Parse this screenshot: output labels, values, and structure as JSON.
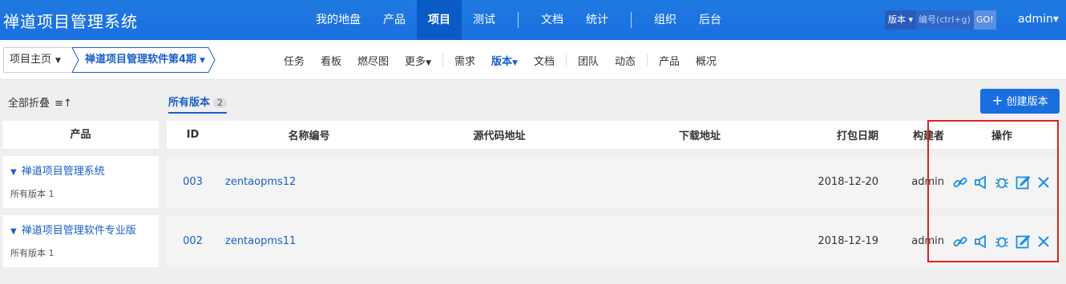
{
  "app": {
    "title": "禅道项目管理系统"
  },
  "main_nav": [
    {
      "label": "我的地盘",
      "active": false
    },
    {
      "label": "产品",
      "active": false
    },
    {
      "label": "项目",
      "active": true
    },
    {
      "label": "测试",
      "active": false
    },
    {
      "label": "文档",
      "active": false
    },
    {
      "label": "统计",
      "active": false
    },
    {
      "label": "组织",
      "active": false
    },
    {
      "label": "后台",
      "active": false
    }
  ],
  "search": {
    "type_label": "版本",
    "placeholder": "编号(ctrl+g)",
    "go_label": "GO!"
  },
  "user": {
    "name": "admin"
  },
  "breadcrumb": {
    "home": "项目主页",
    "project": "禅道项目管理软件第4期"
  },
  "sub_nav": [
    "任务",
    "看板",
    "燃尽图",
    "更多",
    "需求",
    "版本",
    "文档",
    "团队",
    "动态",
    "产品",
    "概况"
  ],
  "toolbar": {
    "fold_all": "全部折叠",
    "tab_label": "所有版本",
    "tab_count": "2",
    "create_label": "创建版本"
  },
  "left_panel": {
    "header": "产品",
    "products": [
      {
        "name": "禅道项目管理系统",
        "count_label": "所有版本 1"
      },
      {
        "name": "禅道项目管理软件专业版",
        "count_label": "所有版本 1"
      }
    ]
  },
  "table": {
    "headers": {
      "id": "ID",
      "name": "名称编号",
      "src": "源代码地址",
      "dl": "下载地址",
      "date": "打包日期",
      "builder": "构建者",
      "ops": "操作"
    },
    "rows": [
      {
        "id": "003",
        "name": "zentaopms12",
        "src": "",
        "dl": "",
        "date": "2018-12-20",
        "builder": "admin"
      },
      {
        "id": "002",
        "name": "zentaopms11",
        "src": "",
        "dl": "",
        "date": "2018-12-19",
        "builder": "admin"
      }
    ]
  },
  "colors": {
    "primary": "#1a6fe0",
    "link": "#1a5fc9",
    "highlight": "#e02020"
  }
}
